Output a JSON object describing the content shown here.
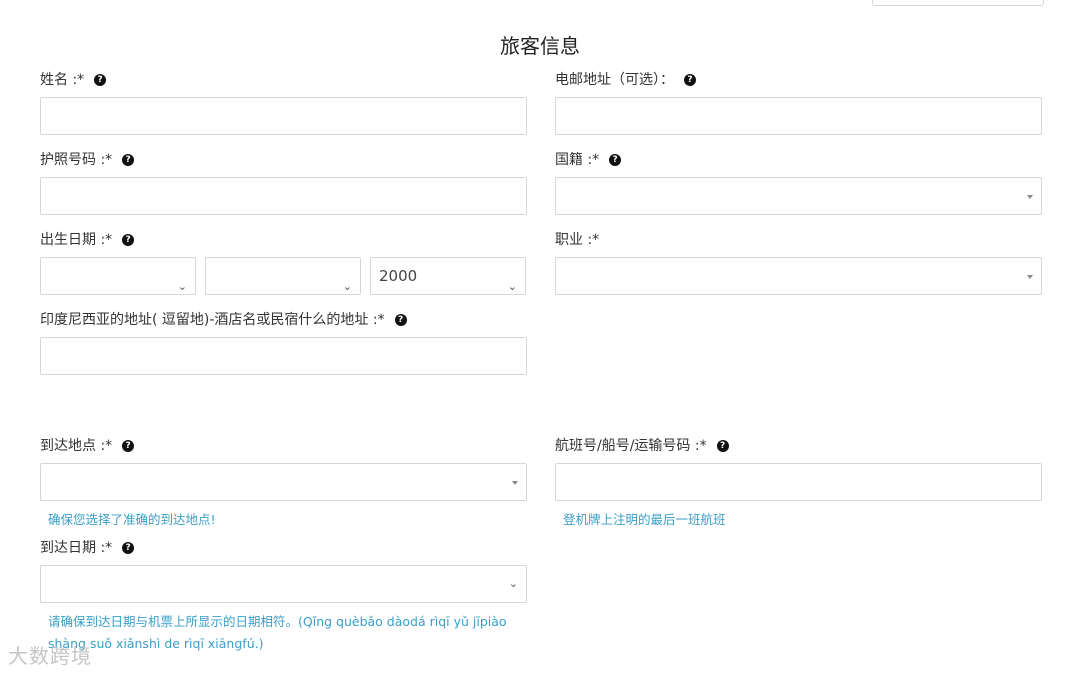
{
  "form": {
    "title": "旅客信息",
    "name_label": "姓名 :*",
    "email_label": "电邮地址（可选）：",
    "passport_label": "护照号码 :*",
    "nationality_label": "国籍 :*",
    "dob_label": "出生日期 :*",
    "dob_year_value": "2000",
    "occupation_label": "职业 :*",
    "address_label": "印度尼西亚的地址( 逗留地)-酒店名或民宿什么的地址 :*",
    "arrival_place_label": "到达地点 :*",
    "arrival_place_note": "确保您选择了准确的到达地点!",
    "flight_label": "航班号/船号/运输号码 :*",
    "flight_note": "登机牌上注明的最后一班航班",
    "arrival_date_label": "到达日期 :*",
    "arrival_date_note": "请确保到达日期与机票上所显示的日期相符。(Qǐng quèbǎo dàodá rìqī yǔ jīpiào shàng suǒ xiǎnshì de rìqī xiāngfú.)",
    "help_icon": "question-circle-icon"
  },
  "watermark": {
    "text": "大数跨境"
  },
  "colors": {
    "note": "#3a9fc8",
    "border": "#d6d6d6"
  }
}
